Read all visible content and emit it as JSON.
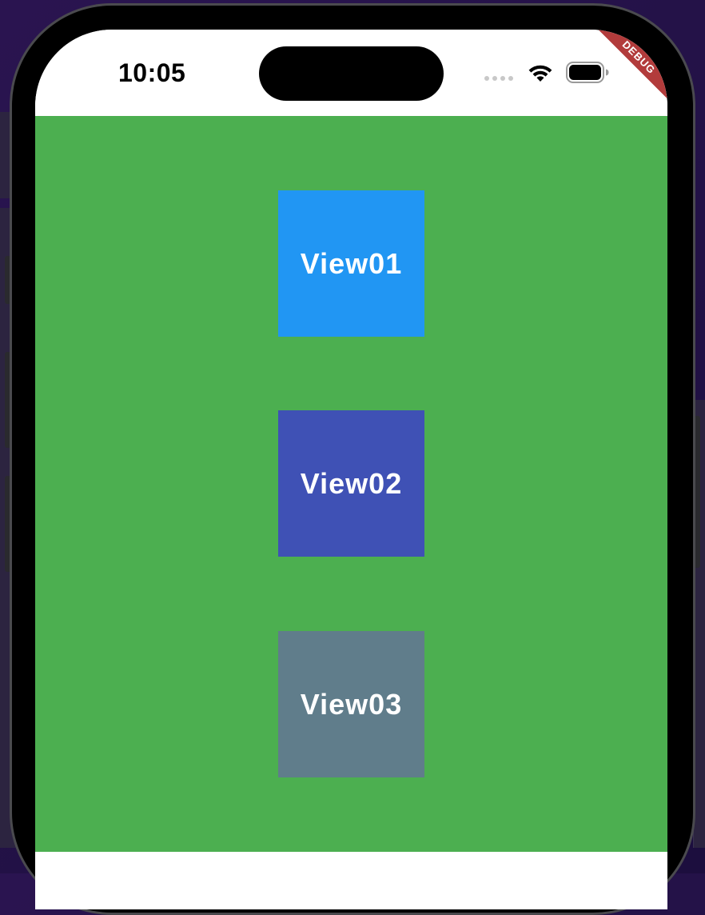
{
  "status_bar": {
    "time": "10:05",
    "wifi_icon": "wifi-icon",
    "battery_icon": "battery-icon",
    "signal_icon": "signal-dots-icon"
  },
  "debug_banner": {
    "label": "DEBUG",
    "color": "#b23b3b"
  },
  "content": {
    "background": "#4caf50",
    "views": [
      {
        "label": "View01",
        "color": "#2196f3"
      },
      {
        "label": "View02",
        "color": "#3f51b5"
      },
      {
        "label": "View03",
        "color": "#607d8b"
      }
    ]
  }
}
